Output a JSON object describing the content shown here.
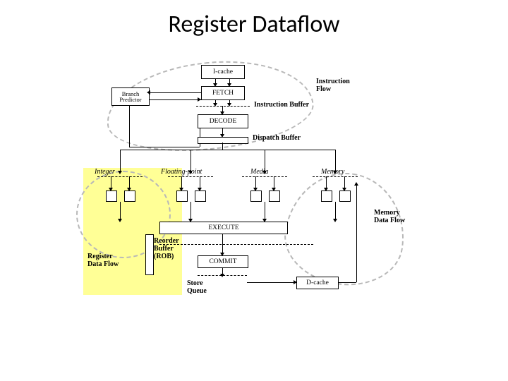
{
  "title": "Register Dataflow",
  "blocks": {
    "icache": "I-cache",
    "fetch": "FETCH",
    "branch_predictor": "Branch Predictor",
    "decode": "DECODE",
    "execute": "EXECUTE",
    "commit": "COMMIT",
    "dcache": "D-cache"
  },
  "labels": {
    "instruction_flow": "Instruction Flow",
    "instruction_buffer": "Instruction Buffer",
    "dispatch_buffer": "Dispatch Buffer",
    "integer": "Integer",
    "floating_point": "Floating-point",
    "media": "Media",
    "memory": "Memory",
    "reorder_buffer": "Reorder Buffer (ROB)",
    "register_data_flow": "Register Data Flow",
    "memory_data_flow": "Memory Data Flow",
    "store_queue": "Store Queue"
  }
}
